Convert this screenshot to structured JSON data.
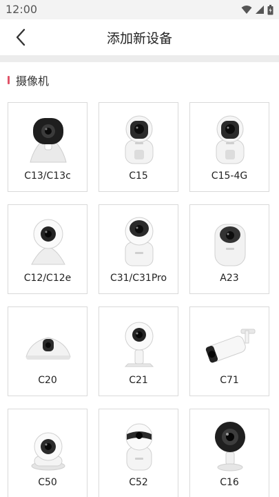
{
  "status": {
    "time": "12:00"
  },
  "header": {
    "title": "添加新设备"
  },
  "section": {
    "title": "摄像机"
  },
  "devices": [
    {
      "label": "C13/C13c",
      "icon": "camera-c13-icon"
    },
    {
      "label": "C15",
      "icon": "camera-c15-icon"
    },
    {
      "label": "C15-4G",
      "icon": "camera-c15-4g-icon"
    },
    {
      "label": "C12/C12e",
      "icon": "camera-c12-icon"
    },
    {
      "label": "C31/C31Pro",
      "icon": "camera-c31-icon"
    },
    {
      "label": "A23",
      "icon": "camera-a23-icon"
    },
    {
      "label": "C20",
      "icon": "camera-c20-icon"
    },
    {
      "label": "C21",
      "icon": "camera-c21-icon"
    },
    {
      "label": "C71",
      "icon": "camera-c71-icon"
    },
    {
      "label": "C50",
      "icon": "camera-c50-icon"
    },
    {
      "label": "C52",
      "icon": "camera-c52-icon"
    },
    {
      "label": "C16",
      "icon": "camera-c16-icon"
    }
  ],
  "colors": {
    "accent": "#e05368",
    "divider": "#ececec",
    "card_border": "#d9d9d9"
  }
}
